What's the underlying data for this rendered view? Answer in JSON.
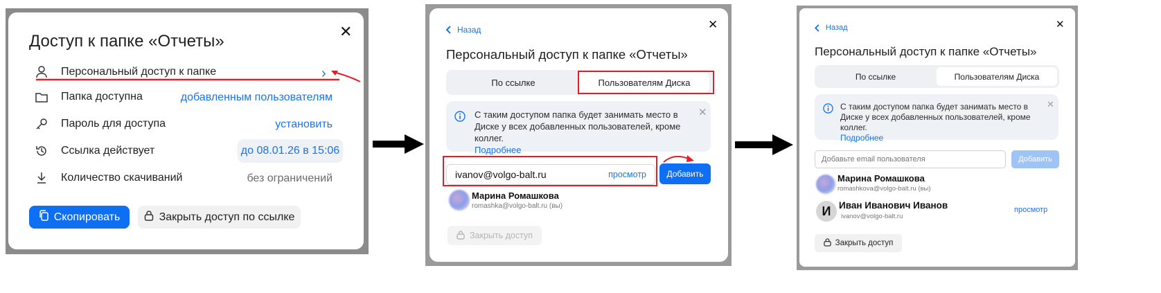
{
  "panel1": {
    "title": "Доступ к папке «Отчеты»",
    "rows": [
      {
        "label": "Персональный доступ к папке",
        "value": ""
      },
      {
        "label": "Папка доступна",
        "value": "добавленным пользователям"
      },
      {
        "label": "Пароль для доступа",
        "value": "установить"
      },
      {
        "label": "Ссылка действует",
        "value": "до 08.01.26 в 15:06"
      },
      {
        "label": "Количество скачиваний",
        "value": "без ограничений"
      }
    ],
    "copy_button": "Скопировать",
    "close_link_button": "Закрыть доступ по ссылке"
  },
  "panel2": {
    "back": "Назад",
    "title": "Персональный доступ к папке «Отчеты»",
    "tabs": [
      "По ссылке",
      "Пользователям Диска"
    ],
    "active_tab": 1,
    "notice": "С таким доступом папка будет занимать место в Диске у всех добавленных пользователей, кроме коллег.",
    "notice_link": "Подробнее",
    "email_value": "ivanov@volgo-balt.ru",
    "role": "просмотр",
    "add_button": "Добавить",
    "users": [
      {
        "name": "Марина Ромашкова",
        "email": "romashka@volgo-balt.ru",
        "suffix": "(вы)"
      }
    ],
    "close_access_button": "Закрыть доступ"
  },
  "panel3": {
    "back": "Назад",
    "title": "Персональный доступ к папке «Отчеты»",
    "tabs": [
      "По ссылке",
      "Пользователям Диска"
    ],
    "active_tab": 1,
    "notice": "С таким доступом папка будет занимать место в Диске у всех добавленных пользователей, кроме коллег.",
    "notice_link": "Подробнее",
    "email_placeholder": "Добавьте email пользователя",
    "add_button": "Добавить",
    "users": [
      {
        "name": "Марина Ромашкова",
        "email": "romashkova@volgo-balt.ru",
        "suffix": "(вы)",
        "initial": "",
        "role": ""
      },
      {
        "name": "Иван Иванович Иванов",
        "email": "ivanov@volgo-balt.ru",
        "suffix": "",
        "initial": "И",
        "role": "просмотр"
      }
    ],
    "close_access_button": "Закрыть доступ"
  },
  "colors": {
    "accent": "#0f6ff2",
    "link": "#1a73e8",
    "highlight": "#e41e26"
  }
}
